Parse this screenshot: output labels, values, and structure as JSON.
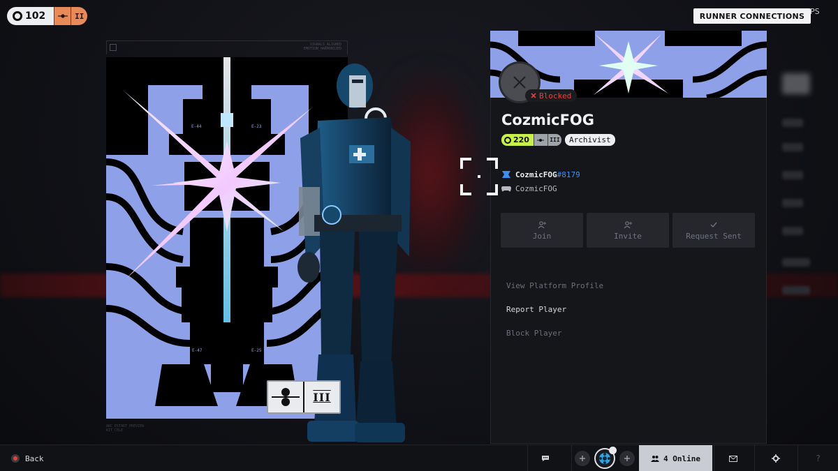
{
  "top": {
    "level": "102",
    "rank_numeral": "II",
    "runner_connections_label": "RUNNER CONNECTIONS",
    "ps_fragment": "PS"
  },
  "art": {
    "frame_tag_line1": "SIGNALS_ALIGNED",
    "frame_tag_line2": "EMOTION_HARMONIZED",
    "labels": [
      "E-44",
      "E-23",
      "E-47",
      "E-25"
    ],
    "footer_line1": "ARC_ESTART_PREVIEW",
    "footer_line2": "KIT_CELE",
    "rank_plate_numeral": "III"
  },
  "profile": {
    "username": "CozmicFOG",
    "status_label": "Blocked",
    "level": "220",
    "rank_numeral": "III",
    "title": "Archivist",
    "embark_name": "CozmicFOG",
    "embark_tag": "#8179",
    "platform_name": "CozmicFOG",
    "actions": [
      {
        "label": "Join",
        "icon": "person-add-icon"
      },
      {
        "label": "Invite",
        "icon": "person-add-icon"
      },
      {
        "label": "Request Sent",
        "icon": "check-icon"
      }
    ],
    "menu": [
      {
        "label": "View Platform Profile",
        "state": "dim"
      },
      {
        "label": "Report Player",
        "state": "lit"
      },
      {
        "label": "Block Player",
        "state": "dim"
      }
    ]
  },
  "bottom": {
    "back_label": "Back",
    "online_label": "4 Online",
    "help_label": "?"
  },
  "colors": {
    "accent_level": "#c8f04a",
    "blocked_red": "#e8403c",
    "embark_blue": "#3d8ef0",
    "rank_orange": "#e8895a",
    "art_blue": "#8ea1e8"
  }
}
